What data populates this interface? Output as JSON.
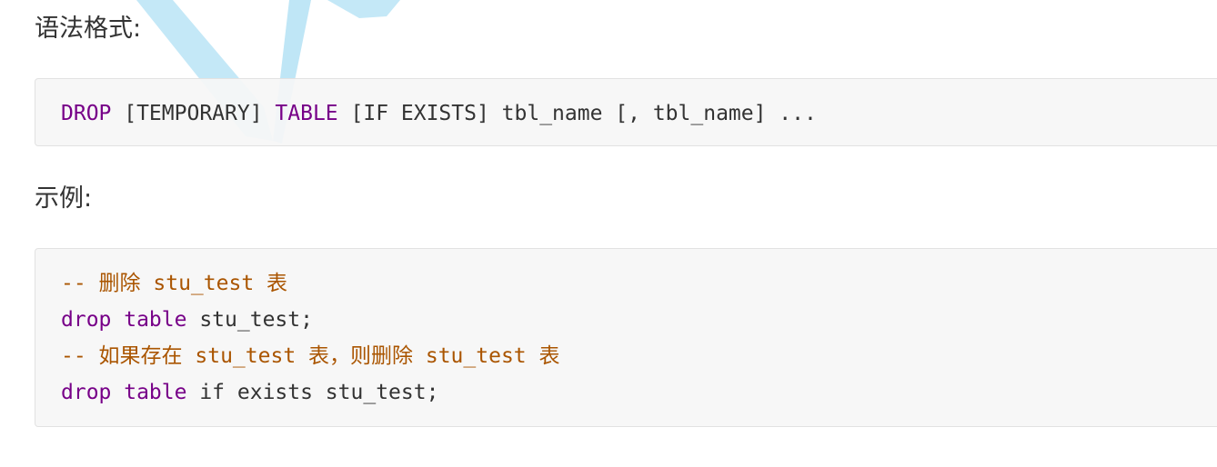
{
  "headings": {
    "syntax": "语法格式:",
    "example": "示例:"
  },
  "syntax_code": {
    "kw_drop": "DROP",
    "txt_temporary": " [TEMPORARY] ",
    "kw_table": "TABLE",
    "txt_rest": " [IF EXISTS] tbl_name [, tbl_name] ..."
  },
  "example_code": {
    "line1_comment": "-- 删除 stu_test 表",
    "line2_kw": "drop table",
    "line2_rest": " stu_test;",
    "line3_comment": "-- 如果存在 stu_test 表，则删除 stu_test 表",
    "line4_kw": "drop table",
    "line4_rest": " if exists stu_test;"
  },
  "colors": {
    "keyword": "#770088",
    "comment": "#aa5500",
    "text": "#333333",
    "code_background": "#f6f6f6",
    "watermark": "#bfe6f6"
  }
}
